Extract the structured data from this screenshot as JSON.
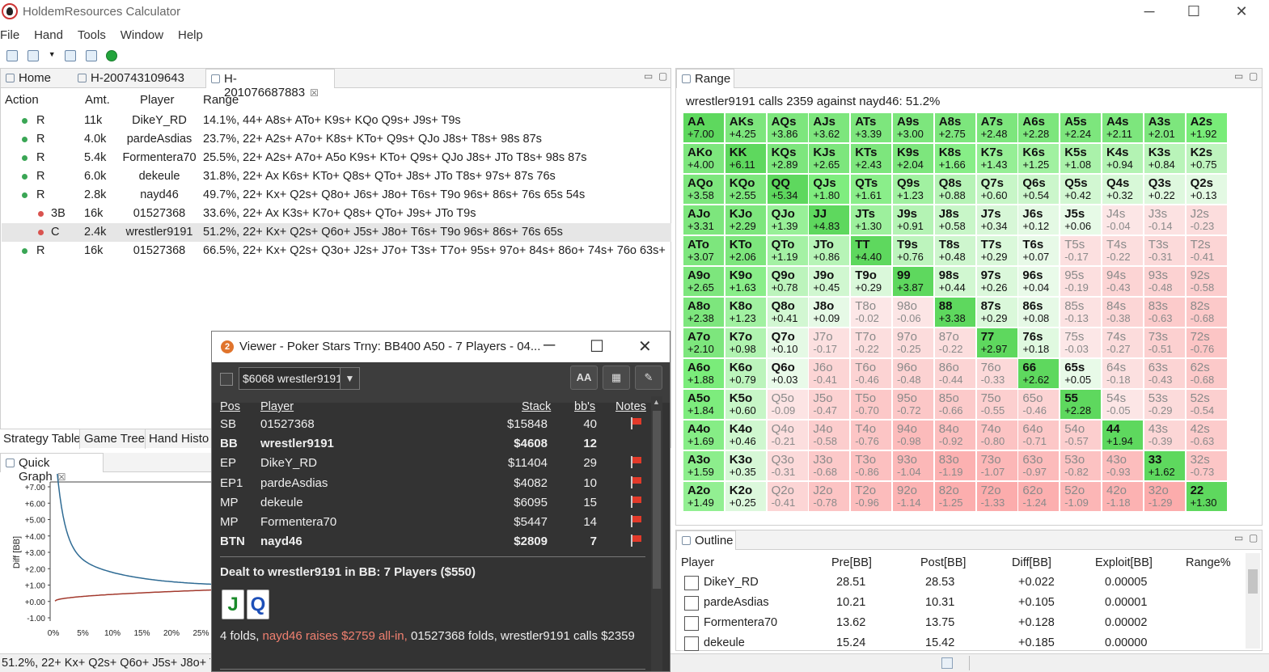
{
  "window": {
    "title": "HoldemResources Calculator",
    "minimize": "─",
    "maximize": "☐",
    "close": "✕"
  },
  "menu": [
    "File",
    "Hand",
    "Tools",
    "Window",
    "Help"
  ],
  "tabs": [
    {
      "label": "Home"
    },
    {
      "label": "H-200743109643"
    },
    {
      "label": "H-201076687883",
      "close": "☒"
    }
  ],
  "actions": {
    "headers": [
      "Action",
      "Amt.",
      "Player",
      "Range"
    ],
    "rows": [
      {
        "action": "R",
        "amt": "11k",
        "player": "DikeY_RD",
        "range": "14.1%, 44+ A8s+ ATo+ K9s+ KQo Q9s+ J9s+ T9s",
        "dot": "#3aa655",
        "indent": 0
      },
      {
        "action": "R",
        "amt": "4.0k",
        "player": "pardeAsdias",
        "range": "23.7%, 22+ A2s+ A7o+ K8s+ KTo+ Q9s+ QJo J8s+ T8s+ 98s 87s",
        "dot": "#3aa655",
        "indent": 0
      },
      {
        "action": "R",
        "amt": "5.4k",
        "player": "Formentera70",
        "range": "25.5%, 22+ A2s+ A7o+ A5o K9s+ KTo+ Q9s+ QJo J8s+ JTo T8s+ 98s 87s",
        "dot": "#3aa655",
        "indent": 0
      },
      {
        "action": "R",
        "amt": "6.0k",
        "player": "dekeule",
        "range": "31.8%, 22+ Ax K6s+ KTo+ Q8s+ QTo+ J8s+ JTo T8s+ 97s+ 87s 76s",
        "dot": "#3aa655",
        "indent": 0
      },
      {
        "action": "R",
        "amt": "2.8k",
        "player": "nayd46",
        "range": "49.7%, 22+ Kx+ Q2s+ Q8o+ J6s+ J8o+ T6s+ T9o 96s+ 86s+ 76s 65s 54s",
        "dot": "#3aa655",
        "indent": 0
      },
      {
        "action": "3B",
        "amt": "16k",
        "player": "01527368",
        "range": "33.6%, 22+ Ax K3s+ K7o+ Q8s+ QTo+ J9s+ JTo T9s",
        "dot": "#d9534f",
        "indent": 1
      },
      {
        "action": "C",
        "amt": "2.4k",
        "player": "wrestler9191",
        "range": "51.2%, 22+ Kx+ Q2s+ Q6o+ J5s+ J8o+ T6s+ T9o 96s+ 86s+ 76s 65s",
        "dot": "#d9534f",
        "indent": 1,
        "selected": true
      },
      {
        "action": "R",
        "amt": "16k",
        "player": "01527368",
        "range": "66.5%, 22+ Kx+ Q2s+ Q3o+ J2s+ J7o+ T3s+ T7o+ 95s+ 97o+ 84s+ 86o+ 74s+ 76o 63s+",
        "dot": "#3aa655",
        "indent": 0
      }
    ]
  },
  "bottom_tabs": [
    "Strategy Table",
    "Game Tree",
    "Hand Histo"
  ],
  "quick_graph": {
    "tab": "Quick Graph",
    "close": "☒",
    "ylabel": "Diff [BB]",
    "yticks": [
      "+7.00",
      "+6.00",
      "+5.00",
      "+4.00",
      "+3.00",
      "+2.00",
      "+1.00",
      "+0.00",
      "-1.00"
    ],
    "xticks": [
      "0%",
      "5%",
      "10%",
      "15%",
      "20%",
      "25%"
    ]
  },
  "status_text": "51.2%, 22+ Kx+ Q2s+ Q6o+ J5s+ J8o+ T",
  "range": {
    "tab": "Range",
    "subtitle": "wrestler9191 calls 2359 against nayd46: 51.2%",
    "cells": [
      [
        [
          "AA",
          "+7.00"
        ],
        [
          "AKs",
          "+4.25"
        ],
        [
          "AQs",
          "+3.86"
        ],
        [
          "AJs",
          "+3.62"
        ],
        [
          "ATs",
          "+3.39"
        ],
        [
          "A9s",
          "+3.00"
        ],
        [
          "A8s",
          "+2.75"
        ],
        [
          "A7s",
          "+2.48"
        ],
        [
          "A6s",
          "+2.28"
        ],
        [
          "A5s",
          "+2.24"
        ],
        [
          "A4s",
          "+2.11"
        ],
        [
          "A3s",
          "+2.01"
        ],
        [
          "A2s",
          "+1.92"
        ]
      ],
      [
        [
          "AKo",
          "+4.00"
        ],
        [
          "KK",
          "+6.11"
        ],
        [
          "KQs",
          "+2.89"
        ],
        [
          "KJs",
          "+2.65"
        ],
        [
          "KTs",
          "+2.43"
        ],
        [
          "K9s",
          "+2.04"
        ],
        [
          "K8s",
          "+1.66"
        ],
        [
          "K7s",
          "+1.43"
        ],
        [
          "K6s",
          "+1.25"
        ],
        [
          "K5s",
          "+1.08"
        ],
        [
          "K4s",
          "+0.94"
        ],
        [
          "K3s",
          "+0.84"
        ],
        [
          "K2s",
          "+0.75"
        ]
      ],
      [
        [
          "AQo",
          "+3.58"
        ],
        [
          "KQo",
          "+2.55"
        ],
        [
          "QQ",
          "+5.34"
        ],
        [
          "QJs",
          "+1.80"
        ],
        [
          "QTs",
          "+1.61"
        ],
        [
          "Q9s",
          "+1.23"
        ],
        [
          "Q8s",
          "+0.88"
        ],
        [
          "Q7s",
          "+0.60"
        ],
        [
          "Q6s",
          "+0.54"
        ],
        [
          "Q5s",
          "+0.42"
        ],
        [
          "Q4s",
          "+0.32"
        ],
        [
          "Q3s",
          "+0.22"
        ],
        [
          "Q2s",
          "+0.13"
        ]
      ],
      [
        [
          "AJo",
          "+3.31"
        ],
        [
          "KJo",
          "+2.29"
        ],
        [
          "QJo",
          "+1.39"
        ],
        [
          "JJ",
          "+4.83"
        ],
        [
          "JTs",
          "+1.30"
        ],
        [
          "J9s",
          "+0.91"
        ],
        [
          "J8s",
          "+0.58"
        ],
        [
          "J7s",
          "+0.34"
        ],
        [
          "J6s",
          "+0.12"
        ],
        [
          "J5s",
          "+0.06"
        ],
        [
          "J4s",
          "-0.04"
        ],
        [
          "J3s",
          "-0.14"
        ],
        [
          "J2s",
          "-0.23"
        ]
      ],
      [
        [
          "ATo",
          "+3.07"
        ],
        [
          "KTo",
          "+2.06"
        ],
        [
          "QTo",
          "+1.19"
        ],
        [
          "JTo",
          "+0.86"
        ],
        [
          "TT",
          "+4.40"
        ],
        [
          "T9s",
          "+0.76"
        ],
        [
          "T8s",
          "+0.48"
        ],
        [
          "T7s",
          "+0.29"
        ],
        [
          "T6s",
          "+0.07"
        ],
        [
          "T5s",
          "-0.17"
        ],
        [
          "T4s",
          "-0.22"
        ],
        [
          "T3s",
          "-0.31"
        ],
        [
          "T2s",
          "-0.41"
        ]
      ],
      [
        [
          "A9o",
          "+2.65"
        ],
        [
          "K9o",
          "+1.63"
        ],
        [
          "Q9o",
          "+0.78"
        ],
        [
          "J9o",
          "+0.45"
        ],
        [
          "T9o",
          "+0.29"
        ],
        [
          "99",
          "+3.87"
        ],
        [
          "98s",
          "+0.44"
        ],
        [
          "97s",
          "+0.26"
        ],
        [
          "96s",
          "+0.04"
        ],
        [
          "95s",
          "-0.19"
        ],
        [
          "94s",
          "-0.43"
        ],
        [
          "93s",
          "-0.48"
        ],
        [
          "92s",
          "-0.58"
        ]
      ],
      [
        [
          "A8o",
          "+2.38"
        ],
        [
          "K8o",
          "+1.23"
        ],
        [
          "Q8o",
          "+0.41"
        ],
        [
          "J8o",
          "+0.09"
        ],
        [
          "T8o",
          "-0.02"
        ],
        [
          "98o",
          "-0.06"
        ],
        [
          "88",
          "+3.38"
        ],
        [
          "87s",
          "+0.29"
        ],
        [
          "86s",
          "+0.08"
        ],
        [
          "85s",
          "-0.13"
        ],
        [
          "84s",
          "-0.38"
        ],
        [
          "83s",
          "-0.63"
        ],
        [
          "82s",
          "-0.68"
        ]
      ],
      [
        [
          "A7o",
          "+2.10"
        ],
        [
          "K7o",
          "+0.98"
        ],
        [
          "Q7o",
          "+0.10"
        ],
        [
          "J7o",
          "-0.17"
        ],
        [
          "T7o",
          "-0.22"
        ],
        [
          "97o",
          "-0.25"
        ],
        [
          "87o",
          "-0.22"
        ],
        [
          "77",
          "+2.97"
        ],
        [
          "76s",
          "+0.18"
        ],
        [
          "75s",
          "-0.03"
        ],
        [
          "74s",
          "-0.27"
        ],
        [
          "73s",
          "-0.51"
        ],
        [
          "72s",
          "-0.76"
        ]
      ],
      [
        [
          "A6o",
          "+1.88"
        ],
        [
          "K6o",
          "+0.79"
        ],
        [
          "Q6o",
          "+0.03"
        ],
        [
          "J6o",
          "-0.41"
        ],
        [
          "T6o",
          "-0.46"
        ],
        [
          "96o",
          "-0.48"
        ],
        [
          "86o",
          "-0.44"
        ],
        [
          "76o",
          "-0.33"
        ],
        [
          "66",
          "+2.62"
        ],
        [
          "65s",
          "+0.05"
        ],
        [
          "64s",
          "-0.18"
        ],
        [
          "63s",
          "-0.43"
        ],
        [
          "62s",
          "-0.68"
        ]
      ],
      [
        [
          "A5o",
          "+1.84"
        ],
        [
          "K5o",
          "+0.60"
        ],
        [
          "Q5o",
          "-0.09"
        ],
        [
          "J5o",
          "-0.47"
        ],
        [
          "T5o",
          "-0.70"
        ],
        [
          "95o",
          "-0.72"
        ],
        [
          "85o",
          "-0.66"
        ],
        [
          "75o",
          "-0.55"
        ],
        [
          "65o",
          "-0.46"
        ],
        [
          "55",
          "+2.28"
        ],
        [
          "54s",
          "-0.05"
        ],
        [
          "53s",
          "-0.29"
        ],
        [
          "52s",
          "-0.54"
        ]
      ],
      [
        [
          "A4o",
          "+1.69"
        ],
        [
          "K4o",
          "+0.46"
        ],
        [
          "Q4o",
          "-0.21"
        ],
        [
          "J4o",
          "-0.58"
        ],
        [
          "T4o",
          "-0.76"
        ],
        [
          "94o",
          "-0.98"
        ],
        [
          "84o",
          "-0.92"
        ],
        [
          "74o",
          "-0.80"
        ],
        [
          "64o",
          "-0.71"
        ],
        [
          "54o",
          "-0.57"
        ],
        [
          "44",
          "+1.94"
        ],
        [
          "43s",
          "-0.39"
        ],
        [
          "42s",
          "-0.63"
        ]
      ],
      [
        [
          "A3o",
          "+1.59"
        ],
        [
          "K3o",
          "+0.35"
        ],
        [
          "Q3o",
          "-0.31"
        ],
        [
          "J3o",
          "-0.68"
        ],
        [
          "T3o",
          "-0.86"
        ],
        [
          "93o",
          "-1.04"
        ],
        [
          "83o",
          "-1.19"
        ],
        [
          "73o",
          "-1.07"
        ],
        [
          "63o",
          "-0.97"
        ],
        [
          "53o",
          "-0.82"
        ],
        [
          "43o",
          "-0.93"
        ],
        [
          "33",
          "+1.62"
        ],
        [
          "32s",
          "-0.73"
        ]
      ],
      [
        [
          "A2o",
          "+1.49"
        ],
        [
          "K2o",
          "+0.25"
        ],
        [
          "Q2o",
          "-0.41"
        ],
        [
          "J2o",
          "-0.78"
        ],
        [
          "T2o",
          "-0.96"
        ],
        [
          "92o",
          "-1.14"
        ],
        [
          "82o",
          "-1.25"
        ],
        [
          "72o",
          "-1.33"
        ],
        [
          "62o",
          "-1.24"
        ],
        [
          "52o",
          "-1.09"
        ],
        [
          "42o",
          "-1.18"
        ],
        [
          "32o",
          "-1.29"
        ],
        [
          "22",
          "+1.30"
        ]
      ]
    ]
  },
  "outline": {
    "tab": "Outline",
    "headers": [
      "Player",
      "Pre[BB]",
      "Post[BB]",
      "Diff[BB]",
      "Exploit[BB]",
      "Range%"
    ],
    "rows": [
      {
        "player": "DikeY_RD",
        "pre": "28.51",
        "post": "28.53",
        "diff": "+0.022",
        "exploit": "0.00005"
      },
      {
        "player": "pardeAsdias",
        "pre": "10.21",
        "post": "10.31",
        "diff": "+0.105",
        "exploit": "0.00001"
      },
      {
        "player": "Formentera70",
        "pre": "13.62",
        "post": "13.75",
        "diff": "+0.128",
        "exploit": "0.00002"
      },
      {
        "player": "dekeule",
        "pre": "15.24",
        "post": "15.42",
        "diff": "+0.185",
        "exploit": "0.00000"
      }
    ]
  },
  "viewer": {
    "badge": "2",
    "title": "Viewer - Poker Stars Trny: BB400 A50 - 7 Players - 04...",
    "select_value": "$6068 wrestler9191",
    "font_btn": "AA",
    "headers": {
      "pos": "Pos",
      "player": "Player",
      "stack": "Stack",
      "bbs": "bb's",
      "notes": "Notes"
    },
    "players": [
      {
        "pos": "SB",
        "player": "01527368",
        "stack": "$15848",
        "bbs": "40",
        "flag": true,
        "bold": false
      },
      {
        "pos": "BB",
        "player": "wrestler9191",
        "stack": "$4608",
        "bbs": "12",
        "flag": false,
        "bold": true
      },
      {
        "pos": "EP",
        "player": "DikeY_RD",
        "stack": "$11404",
        "bbs": "29",
        "flag": true,
        "bold": false
      },
      {
        "pos": "EP1",
        "player": "pardeAsdias",
        "stack": "$4082",
        "bbs": "10",
        "flag": true,
        "bold": false
      },
      {
        "pos": "MP",
        "player": "dekeule",
        "stack": "$6095",
        "bbs": "15",
        "flag": true,
        "bold": false
      },
      {
        "pos": "MP",
        "player": "Formentera70",
        "stack": "$5447",
        "bbs": "14",
        "flag": true,
        "bold": false
      },
      {
        "pos": "BTN",
        "player": "nayd46",
        "stack": "$2809",
        "bbs": "7",
        "flag": true,
        "bold": true
      }
    ],
    "dealt": "Dealt to wrestler9191 in BB: 7 Players ($550)",
    "cards": [
      {
        "rank": "J",
        "color": "#1a8a2a"
      },
      {
        "rank": "Q",
        "color": "#1d4fb8"
      }
    ],
    "action_1": "4 folds, ",
    "action_2": "nayd46 raises $2759 all-in, ",
    "action_3": "01527368 folds, wrestler9191 calls $2359",
    "action_raise_color": "#f08070"
  },
  "colors": {
    "accent_green": "#3aa655",
    "accent_red": "#d9534f"
  }
}
